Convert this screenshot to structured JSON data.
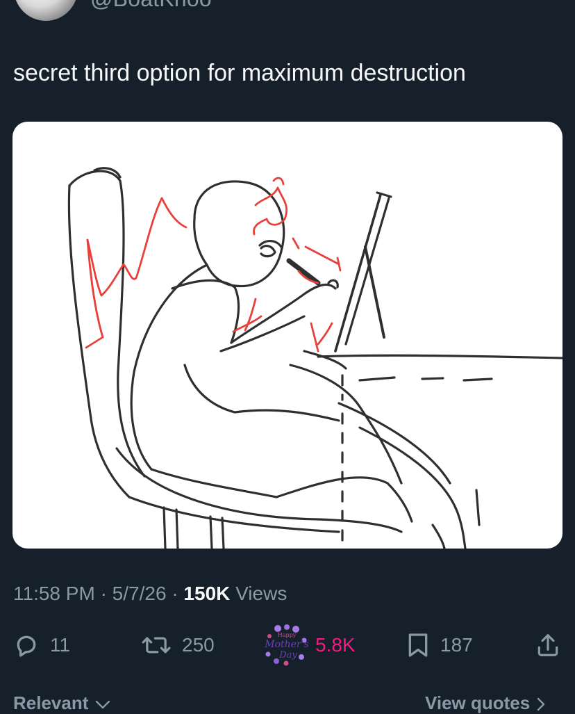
{
  "author": {
    "handle": "@BoatKnoo"
  },
  "tweet": {
    "text": "secret third option for maximum destruction"
  },
  "meta": {
    "time": "11:58 PM",
    "separator": "·",
    "date": "5/7/26",
    "views_count": "150K",
    "views_label": "Views"
  },
  "actions": {
    "reply": {
      "count": "11",
      "icon": "reply-icon"
    },
    "retweet": {
      "count": "250",
      "icon": "retweet-icon"
    },
    "like": {
      "count": "5.8K",
      "icon": "mothers-day-icon",
      "icon_text": [
        "Happy",
        "Mother's",
        "Day"
      ]
    },
    "bookmark": {
      "count": "187",
      "icon": "bookmark-icon"
    },
    "share": {
      "icon": "share-icon"
    }
  },
  "footer": {
    "sort_label": "Relevant",
    "quotes_link": "View quotes"
  },
  "colors": {
    "background": "#15202b",
    "text_primary": "#f7f9f9",
    "text_secondary": "#8b98a5",
    "like_pink": "#f91880",
    "sketch_red": "#e8403a"
  }
}
